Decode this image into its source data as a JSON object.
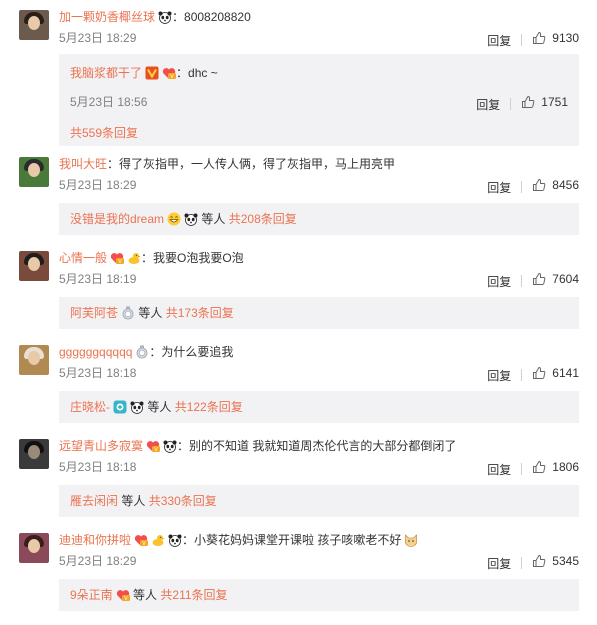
{
  "labels": {
    "reply": "回复",
    "etc": "等人"
  },
  "comments": [
    {
      "user": "加一颗奶香椰丝球",
      "text": "：8008208820",
      "date": "5月23日 18:29",
      "likes": "9130",
      "avatar_color": "#6b5a4e",
      "sub_reply": {
        "user": "我脑浆都干了",
        "text": "：dhc ~",
        "date": "5月23日 18:56",
        "likes": "1751"
      },
      "sub_total": "共559条回复"
    },
    {
      "user": "我叫大旺",
      "text": "：得了灰指甲，一人传人俩，得了灰指甲，马上用亮甲",
      "date": "5月23日 18:29",
      "likes": "8456",
      "avatar_color": "#4a7a3a",
      "sub_users": "没错是我的dream",
      "sub_total": "共208条回复"
    },
    {
      "user": "心情一般",
      "text": "：我要O泡我要O泡",
      "date": "5月23日 18:19",
      "likes": "7604",
      "avatar_color": "#7a4a3a",
      "sub_users": "阿芙阿苍",
      "sub_total": "共173条回复"
    },
    {
      "user": "ggggggqqqqq",
      "text": "：为什么要追我",
      "date": "5月23日 18:18",
      "likes": "6141",
      "avatar_color": "#b08a50",
      "sub_users": "庄晓松-",
      "sub_total": "共122条回复"
    },
    {
      "user": "远望青山多寂寞",
      "text": "：别的不知道 我就知道周杰伦代言的大部分都倒闭了",
      "date": "5月23日 18:18",
      "likes": "1806",
      "avatar_color": "#3a3a3a",
      "sub_users": "雁去闲闲",
      "sub_total": "共330条回复"
    },
    {
      "user": "迪迪和你拼啦",
      "text": "：小葵花妈妈课堂开课啦 孩子咳嗽老不好",
      "date": "5月23日 18:29",
      "likes": "5345",
      "avatar_color": "#8a4a5a",
      "sub_users": "9朵正南",
      "sub_total": "共211条回复"
    }
  ],
  "icons": {
    "like": "thumbs-up-icon",
    "panda": "panda-emoji-icon",
    "vip": "vip-badge-icon",
    "fan": "fan-badge-icon",
    "duck": "duck-emoji-icon",
    "medal": "medal-badge-icon",
    "camera": "camera-badge-icon",
    "grin": "grin-emoji-icon",
    "cat": "cat-emoji-icon"
  },
  "colors": {
    "username": "#eb7350",
    "subbox": "#f2f2f5",
    "date": "#808080"
  }
}
